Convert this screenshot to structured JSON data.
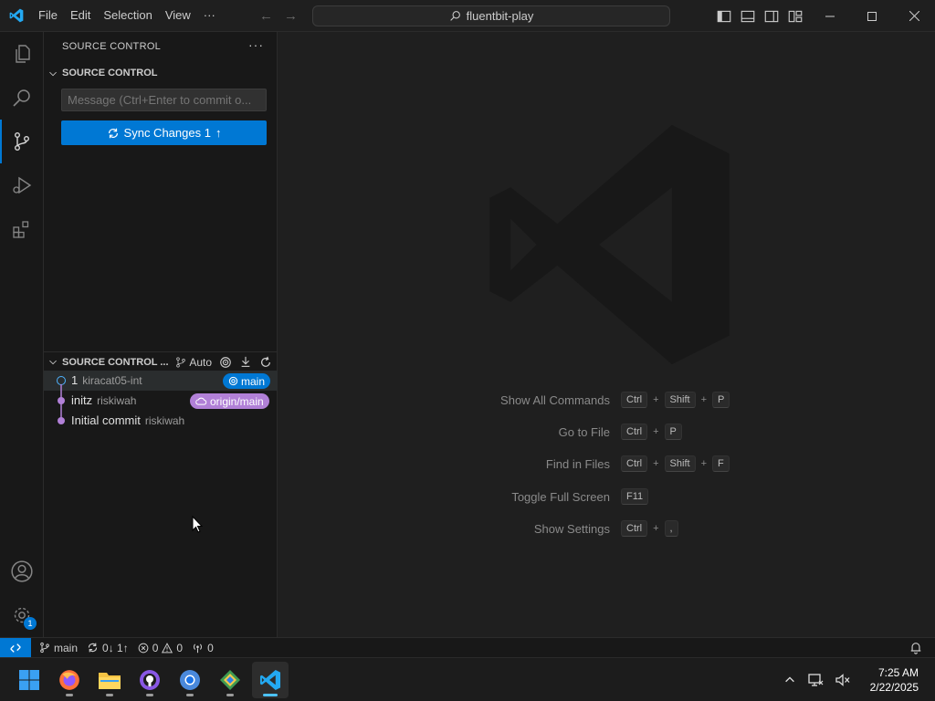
{
  "menu": {
    "file": "File",
    "edit": "Edit",
    "selection": "Selection",
    "view": "View",
    "more": "···"
  },
  "command_center": {
    "label": "fluentbit-play"
  },
  "activity": {
    "settings_badge": "1"
  },
  "sidebar": {
    "title": "SOURCE CONTROL",
    "more": "···",
    "section_title": "SOURCE CONTROL",
    "commit_placeholder": "Message (Ctrl+Enter to commit o...",
    "sync_label": "Sync Changes 1",
    "graph_title": "SOURCE CONTROL ...",
    "graph_auto": "Auto",
    "graph": [
      {
        "title": "1",
        "author": "kiracat05-int",
        "tag": "main",
        "tag_color": "#0078d4",
        "dot_color": "#4fb3ff"
      },
      {
        "title": "initz",
        "author": "riskiwah",
        "tag": "origin/main",
        "tag_color": "#b180d7",
        "dot_color": "#b180d7"
      },
      {
        "title": "Initial commit",
        "author": "riskiwah",
        "tag": "",
        "tag_color": "",
        "dot_color": "#b180d7"
      }
    ]
  },
  "editor": {
    "shortcuts": [
      {
        "label": "Show All Commands",
        "keys": [
          "Ctrl",
          "Shift",
          "P"
        ]
      },
      {
        "label": "Go to File",
        "keys": [
          "Ctrl",
          "P"
        ]
      },
      {
        "label": "Find in Files",
        "keys": [
          "Ctrl",
          "Shift",
          "F"
        ]
      },
      {
        "label": "Toggle Full Screen",
        "keys": [
          "F11"
        ]
      },
      {
        "label": "Show Settings",
        "keys": [
          "Ctrl",
          ","
        ]
      }
    ]
  },
  "statusbar": {
    "branch": "main",
    "sync": "0↓ 1↑",
    "errors": "0",
    "warnings": "0",
    "ports": "0"
  },
  "taskbar": {
    "time": "7:25 AM",
    "date": "2/22/2025"
  },
  "colors": {
    "accent": "#0078d4",
    "bg": "#1f1f1f",
    "panel": "#181818"
  }
}
